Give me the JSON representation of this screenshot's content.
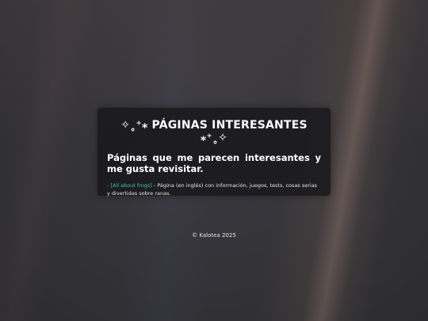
{
  "card": {
    "title": "✧˳⁺⁎ PÁGINAS INTERESANTES ⁎⁺˳✧",
    "subtitle": "Páginas que me parecen interesantes y me gusta revisitar.",
    "items": [
      {
        "bullet": "- ",
        "link_text": "[All about frogs]",
        "description": " - Página (en inglés) con información, juegos, tests, cosas serias y divertidas sobre ranas."
      }
    ]
  },
  "footer": {
    "text": "© Kalotea 2025"
  },
  "colors": {
    "link": "#48c1b5",
    "card_background": "#18181c"
  }
}
